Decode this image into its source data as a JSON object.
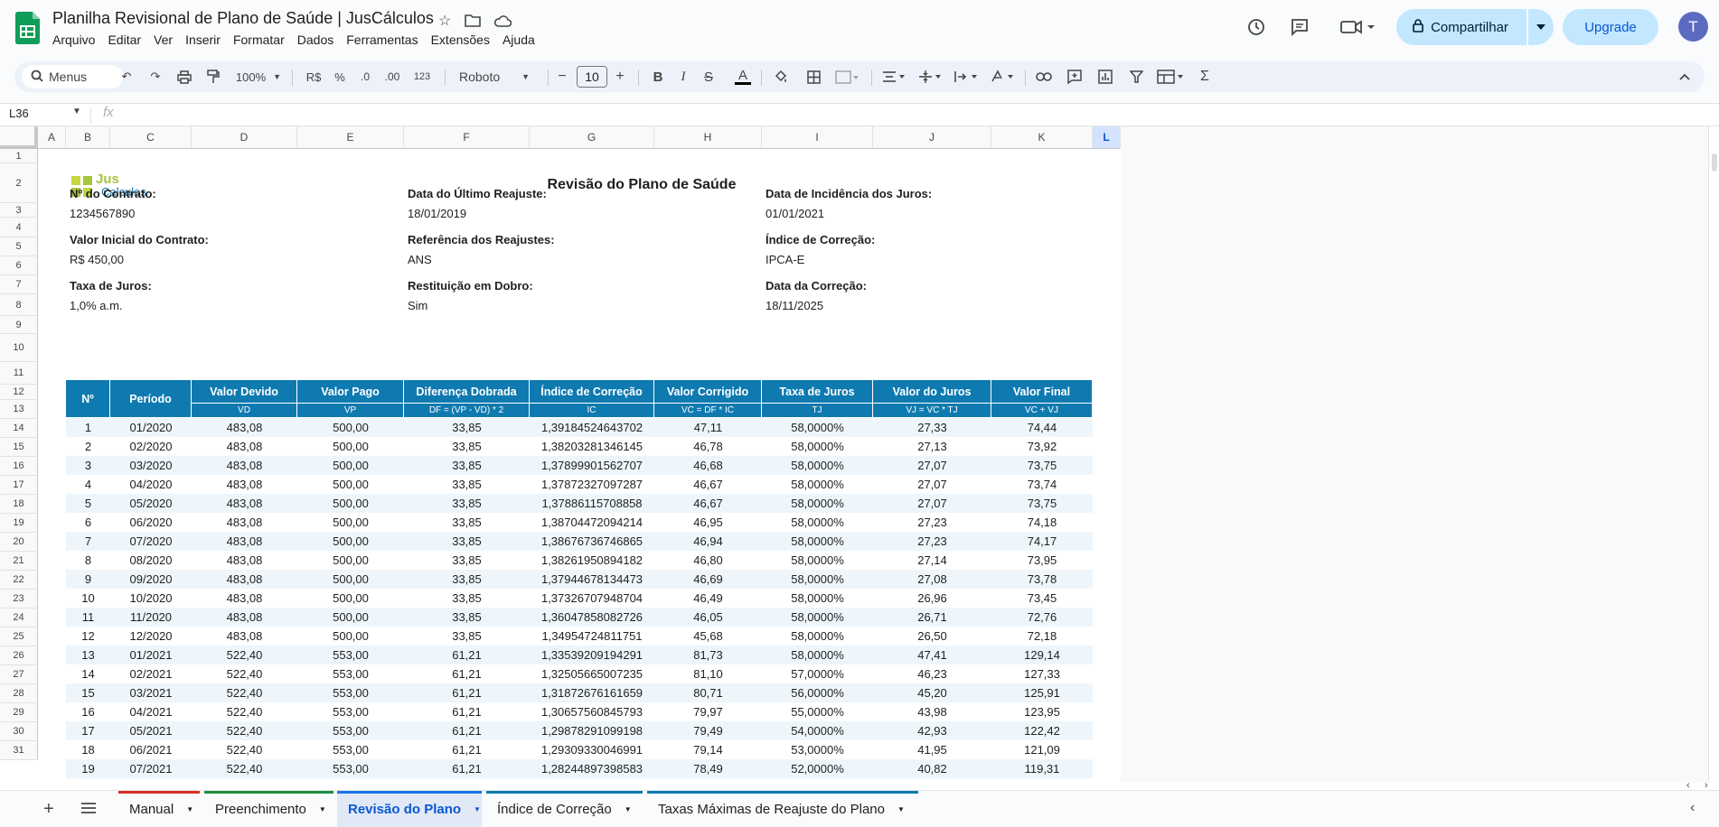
{
  "app": {
    "doc_title": "Planilha Revisional de Plano de Saúde | JusCálculos",
    "menu": [
      "Arquivo",
      "Editar",
      "Ver",
      "Inserir",
      "Formatar",
      "Dados",
      "Ferramentas",
      "Extensões",
      "Ajuda"
    ],
    "share_label": "Compartilhar",
    "upgrade_label": "Upgrade",
    "avatar_letter": "T"
  },
  "toolbar": {
    "search_label": "Menus",
    "zoom": "100%",
    "currency": "R$",
    "percent": "%",
    "dec_minus": ".0",
    "dec_plus": ".00",
    "number_fmt": "123",
    "font": "Roboto",
    "font_size": "10"
  },
  "formula_bar": {
    "cell_ref": "L36",
    "fx": "fx",
    "content": ""
  },
  "columns": [
    "A",
    "B",
    "C",
    "D",
    "E",
    "F",
    "G",
    "H",
    "I",
    "J",
    "K",
    "L"
  ],
  "rows": [
    "1",
    "2",
    "3",
    "4",
    "5",
    "6",
    "7",
    "8",
    "9",
    "10",
    "11",
    "12",
    "13",
    "14",
    "15",
    "16",
    "17",
    "18",
    "19",
    "20",
    "21",
    "22",
    "23",
    "24",
    "25",
    "26",
    "27",
    "28",
    "29",
    "30",
    "31"
  ],
  "report": {
    "logo_top": "Jus",
    "logo_bottom": "Calculos",
    "title": "Revisão do Plano de Saúde",
    "fields": [
      {
        "label": "Nº do Contrato:",
        "value": "1234567890"
      },
      {
        "label": "Data do Último Reajuste:",
        "value": "18/01/2019"
      },
      {
        "label": "Data de Incidência dos Juros:",
        "value": "01/01/2021"
      },
      {
        "label": "Valor Inicial do Contrato:",
        "value": "R$ 450,00"
      },
      {
        "label": "Referência dos Reajustes:",
        "value": "ANS"
      },
      {
        "label": "Índice de Correção:",
        "value": "IPCA-E"
      },
      {
        "label": "Taxa de Juros:",
        "value": "1,0% a.m."
      },
      {
        "label": "Restituição em Dobro:",
        "value": "Sim"
      },
      {
        "label": "Data da Correção:",
        "value": "18/11/2025"
      }
    ],
    "headers": [
      "Nº",
      "Período",
      "Valor Devido",
      "Valor Pago",
      "Diferença Dobrada",
      "Índice de Correção",
      "Valor Corrigido",
      "Taxa de Juros",
      "Valor do Juros",
      "Valor Final"
    ],
    "subheaders": [
      "",
      "",
      "VD",
      "VP",
      "DF = (VP - VD) * 2",
      "IC",
      "VC = DF * IC",
      "TJ",
      "VJ = VC * TJ",
      "VC + VJ"
    ],
    "rows": [
      [
        "1",
        "01/2020",
        "483,08",
        "500,00",
        "33,85",
        "1,39184524643702",
        "47,11",
        "58,0000%",
        "27,33",
        "74,44"
      ],
      [
        "2",
        "02/2020",
        "483,08",
        "500,00",
        "33,85",
        "1,38203281346145",
        "46,78",
        "58,0000%",
        "27,13",
        "73,92"
      ],
      [
        "3",
        "03/2020",
        "483,08",
        "500,00",
        "33,85",
        "1,37899901562707",
        "46,68",
        "58,0000%",
        "27,07",
        "73,75"
      ],
      [
        "4",
        "04/2020",
        "483,08",
        "500,00",
        "33,85",
        "1,37872327097287",
        "46,67",
        "58,0000%",
        "27,07",
        "73,74"
      ],
      [
        "5",
        "05/2020",
        "483,08",
        "500,00",
        "33,85",
        "1,37886115708858",
        "46,67",
        "58,0000%",
        "27,07",
        "73,75"
      ],
      [
        "6",
        "06/2020",
        "483,08",
        "500,00",
        "33,85",
        "1,38704472094214",
        "46,95",
        "58,0000%",
        "27,23",
        "74,18"
      ],
      [
        "7",
        "07/2020",
        "483,08",
        "500,00",
        "33,85",
        "1,38676736746865",
        "46,94",
        "58,0000%",
        "27,23",
        "74,17"
      ],
      [
        "8",
        "08/2020",
        "483,08",
        "500,00",
        "33,85",
        "1,38261950894182",
        "46,80",
        "58,0000%",
        "27,14",
        "73,95"
      ],
      [
        "9",
        "09/2020",
        "483,08",
        "500,00",
        "33,85",
        "1,37944678134473",
        "46,69",
        "58,0000%",
        "27,08",
        "73,78"
      ],
      [
        "10",
        "10/2020",
        "483,08",
        "500,00",
        "33,85",
        "1,37326707948704",
        "46,49",
        "58,0000%",
        "26,96",
        "73,45"
      ],
      [
        "11",
        "11/2020",
        "483,08",
        "500,00",
        "33,85",
        "1,36047858082726",
        "46,05",
        "58,0000%",
        "26,71",
        "72,76"
      ],
      [
        "12",
        "12/2020",
        "483,08",
        "500,00",
        "33,85",
        "1,34954724811751",
        "45,68",
        "58,0000%",
        "26,50",
        "72,18"
      ],
      [
        "13",
        "01/2021",
        "522,40",
        "553,00",
        "61,21",
        "1,33539209194291",
        "81,73",
        "58,0000%",
        "47,41",
        "129,14"
      ],
      [
        "14",
        "02/2021",
        "522,40",
        "553,00",
        "61,21",
        "1,32505665007235",
        "81,10",
        "57,0000%",
        "46,23",
        "127,33"
      ],
      [
        "15",
        "03/2021",
        "522,40",
        "553,00",
        "61,21",
        "1,31872676161659",
        "80,71",
        "56,0000%",
        "45,20",
        "125,91"
      ],
      [
        "16",
        "04/2021",
        "522,40",
        "553,00",
        "61,21",
        "1,30657560845793",
        "79,97",
        "55,0000%",
        "43,98",
        "123,95"
      ],
      [
        "17",
        "05/2021",
        "522,40",
        "553,00",
        "61,21",
        "1,29878291099198",
        "79,49",
        "54,0000%",
        "42,93",
        "122,42"
      ],
      [
        "18",
        "06/2021",
        "522,40",
        "553,00",
        "61,21",
        "1,29309330046991",
        "79,14",
        "53,0000%",
        "41,95",
        "121,09"
      ],
      [
        "19",
        "07/2021",
        "522,40",
        "553,00",
        "61,21",
        "1,28244897398583",
        "78,49",
        "52,0000%",
        "40,82",
        "119,31"
      ]
    ]
  },
  "tabs": [
    {
      "label": "Manual",
      "color": "#d93025"
    },
    {
      "label": "Preenchimento",
      "color": "#1e8e3e"
    },
    {
      "label": "Revisão do Plano",
      "color": "#1a73e8",
      "active": true
    },
    {
      "label": "Índice de Correção",
      "color": "#0f7ab0"
    },
    {
      "label": "Taxas Máximas de Reajuste do Plano",
      "color": "#0f7ab0"
    }
  ],
  "colors": {
    "header_blue": "#0f7ab0",
    "stripe": "#eef6fb",
    "accent": "#c2e7ff"
  }
}
